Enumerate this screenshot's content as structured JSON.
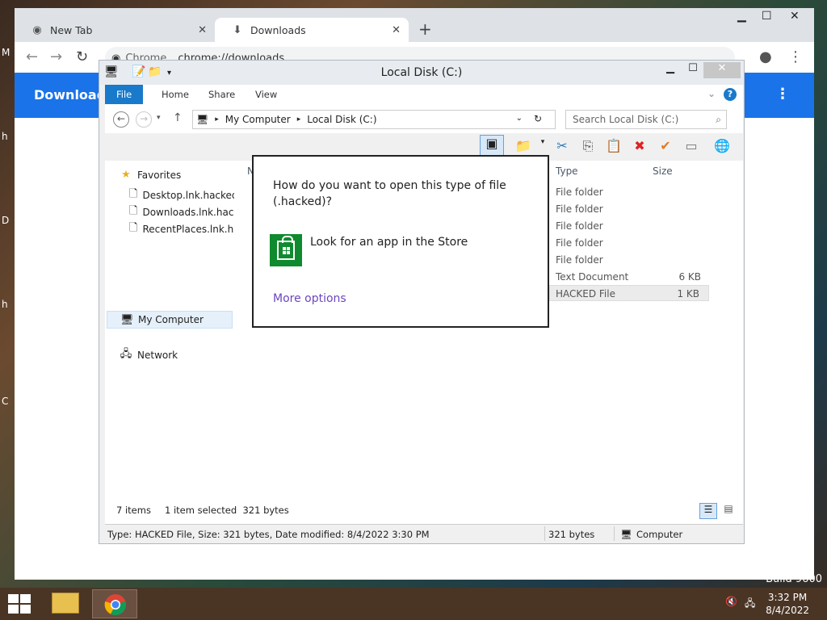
{
  "desktop": {
    "fragments": [
      "M",
      "h",
      "D",
      "h",
      "C"
    ],
    "build_text": "Build 9600"
  },
  "chrome": {
    "tabs": [
      {
        "label": "New Tab",
        "icon": "chrome-icon"
      },
      {
        "label": "Downloads",
        "icon": "download-icon"
      }
    ],
    "omnibox_label": "Chrome",
    "omnibox_url": "chrome://downloads",
    "page_title": "Downloads"
  },
  "explorer": {
    "title": "Local Disk (C:)",
    "ribbon_tabs": [
      "File",
      "Home",
      "Share",
      "View"
    ],
    "breadcrumb": [
      "My Computer",
      "Local Disk (C:)"
    ],
    "search_placeholder": "Search Local Disk (C:)",
    "nav": {
      "favorites": "Favorites",
      "favorite_items": [
        "Desktop.lnk.hacked",
        "Downloads.lnk.hacked",
        "RecentPlaces.lnk.hacked"
      ],
      "my_computer": "My Computer",
      "network": "Network"
    },
    "columns": {
      "name": "N",
      "type": "Type",
      "size": "Size"
    },
    "rows": [
      {
        "type": "File folder",
        "size": ""
      },
      {
        "type": "File folder",
        "size": ""
      },
      {
        "type": "File folder",
        "size": ""
      },
      {
        "type": "File folder",
        "size": ""
      },
      {
        "type": "File folder",
        "size": ""
      },
      {
        "type": "Text Document",
        "size": "6 KB"
      },
      {
        "type": "HACKED File",
        "size": "1 KB"
      }
    ],
    "status": {
      "items": "7 items",
      "selected": "1 item selected  321 bytes",
      "details": "Type: HACKED File, Size: 321 bytes, Date modified: 8/4/2022 3:30 PM",
      "size": "321 bytes",
      "location": "Computer"
    }
  },
  "dialog": {
    "question": "How do you want to open this type of file (.hacked)?",
    "store_option": "Look for an app in the Store",
    "more_options": "More options"
  },
  "taskbar": {
    "time": "3:32 PM",
    "date": "8/4/2022"
  }
}
